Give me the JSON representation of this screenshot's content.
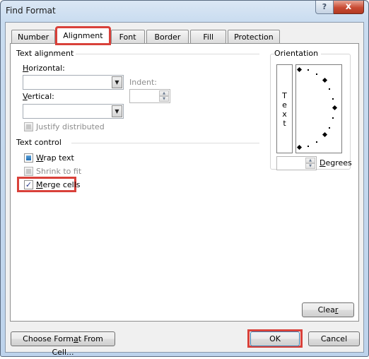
{
  "window": {
    "title": "Find Format",
    "help_icon": "question-mark-icon",
    "help_glyph": "?",
    "close_icon": "close-x-icon",
    "close_glyph": "x"
  },
  "tabs": [
    {
      "label": "Number",
      "active": false
    },
    {
      "label": "Alignment",
      "active": true
    },
    {
      "label": "Font",
      "active": false
    },
    {
      "label": "Border",
      "active": false
    },
    {
      "label": "Fill",
      "active": false
    },
    {
      "label": "Protection",
      "active": false
    }
  ],
  "text_alignment": {
    "group_label": "Text alignment",
    "horizontal": {
      "label_u": "H",
      "label_rest": "orizontal:",
      "value": ""
    },
    "vertical": {
      "label_u": "V",
      "label_rest": "ertical:",
      "value": ""
    },
    "indent": {
      "label": "Indent:",
      "value": ""
    },
    "justify_distributed": {
      "label": "Justify distributed",
      "state": "disabled"
    }
  },
  "text_control": {
    "group_label": "Text control",
    "wrap_text": {
      "label_u": "W",
      "label_rest": "rap text",
      "state": "indeterminate"
    },
    "shrink_to_fit": {
      "label": "Shrink to fit",
      "state": "disabled"
    },
    "merge_cells": {
      "label_u": "M",
      "label_rest": "erge cells",
      "state": "checked",
      "check_glyph": "✓"
    }
  },
  "orientation": {
    "group_label": "Orientation",
    "vertical_text": [
      "T",
      "e",
      "x",
      "t"
    ],
    "degrees": {
      "label_u": "D",
      "label_rest": "egrees",
      "value": ""
    }
  },
  "buttons": {
    "clear_pre": "Clea",
    "clear_u": "r",
    "choose_pre": "Choose Form",
    "choose_u": "a",
    "choose_post": "t From Cell...",
    "ok": "OK",
    "cancel": "Cancel"
  },
  "colors": {
    "highlight": "#d9413a",
    "checkbox_fill": "#1f6db3"
  }
}
